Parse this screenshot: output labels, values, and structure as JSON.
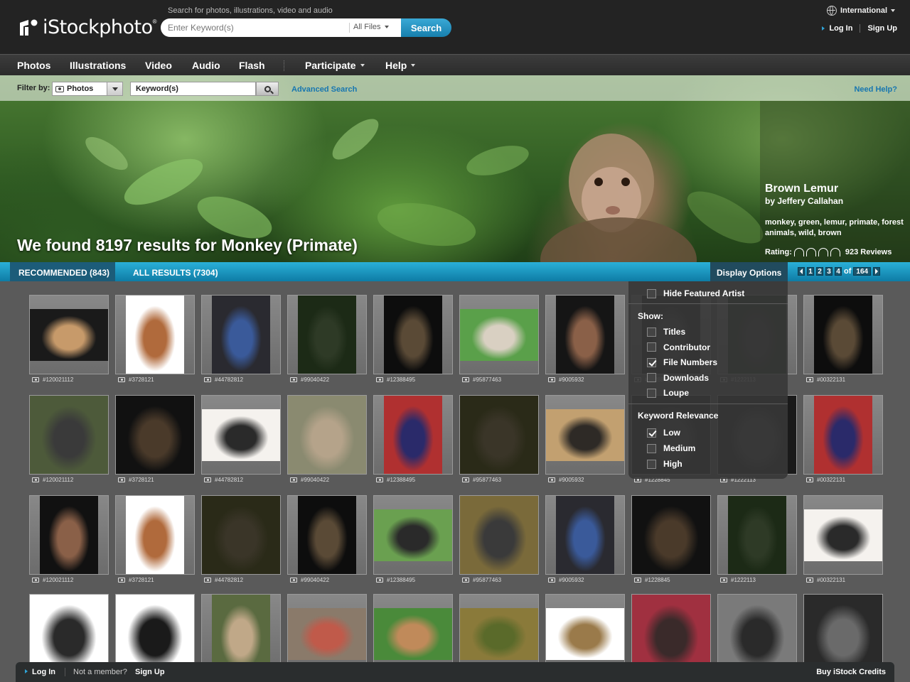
{
  "header": {
    "logo_text": "iStockphoto",
    "logo_reg": "®",
    "search_caption": "Search for photos, illustrations, video and audio",
    "search_placeholder": "Enter Keyword(s)",
    "file_filter": "All Files",
    "search_button": "Search",
    "international": "International",
    "login": "Log In",
    "signup": "Sign Up"
  },
  "nav": {
    "items": [
      "Photos",
      "Illustrations",
      "Video",
      "Audio",
      "Flash",
      "Participate",
      "Help"
    ]
  },
  "filter": {
    "label": "Filter by:",
    "type": "Photos",
    "keyword_value": "Keyword(s)",
    "advanced": "Advanced Search",
    "need_help": "Need Help?"
  },
  "hero": {
    "found_text": "We found 8197 results for Monkey (Primate)",
    "photo_title": "Brown Lemur",
    "photo_by": "by Jeffery Callahan",
    "photo_tags": "monkey, green, lemur, primate, forest animals, wild, brown",
    "rating_label": "Rating:",
    "reviews": "923 Reviews"
  },
  "results_bar": {
    "recommended": "RECOMMENDED (843)",
    "all_results": "ALL RESULTS (7304)",
    "display_options": "Display Options",
    "pages": [
      "1",
      "2",
      "3",
      "4"
    ],
    "of_label": "of",
    "total_pages": "164"
  },
  "display_options": {
    "hide_featured": "Hide Featured Artist",
    "show_label": "Show:",
    "show_items": [
      {
        "label": "Titles",
        "checked": false
      },
      {
        "label": "Contributor",
        "checked": false
      },
      {
        "label": "File Numbers",
        "checked": true
      },
      {
        "label": "Downloads",
        "checked": false
      },
      {
        "label": "Loupe",
        "checked": false
      }
    ],
    "relevance_label": "Keyword Relevance",
    "relevance_items": [
      {
        "label": "Low",
        "checked": true
      },
      {
        "label": "Medium",
        "checked": false
      },
      {
        "label": "High",
        "checked": false
      }
    ]
  },
  "grid": {
    "rows": [
      [
        {
          "id": "#120021112",
          "bg": "#1a1a1a",
          "subject": "#c79a6a",
          "shape": "wide"
        },
        {
          "id": "#3728121",
          "bg": "#ffffff",
          "subject": "#b06a3c",
          "shape": "tall"
        },
        {
          "id": "#44782812",
          "bg": "#2a2a30",
          "subject": "#3a5a9a",
          "shape": "tall"
        },
        {
          "id": "#99040422",
          "bg": "#1c2a16",
          "subject": "#2e3a26",
          "shape": "tall"
        },
        {
          "id": "#12388495",
          "bg": "#0d0d0d",
          "subject": "#5a4a36",
          "shape": "tall"
        },
        {
          "id": "#95877463",
          "bg": "#5aa04a",
          "subject": "#d9d0c2",
          "shape": "wide"
        },
        {
          "id": "#9005932",
          "bg": "#151515",
          "subject": "#8a6048",
          "shape": "tall"
        },
        {
          "id": "#1228845",
          "bg": "#1a1a1a",
          "subject": "#444",
          "shape": "tall"
        },
        {
          "id": "#1222113",
          "bg": "#1c2a16",
          "subject": "#333",
          "shape": "tall"
        },
        {
          "id": "#00322131",
          "bg": "#0d0d0d",
          "subject": "#5a4a36",
          "shape": "tall"
        }
      ],
      [
        {
          "id": "#120021112",
          "bg": "#4d5a3a",
          "subject": "#3a3a3a",
          "shape": "square"
        },
        {
          "id": "#3728121",
          "bg": "#111",
          "subject": "#4a3a2a",
          "shape": "square"
        },
        {
          "id": "#44782812",
          "bg": "#f5f2ee",
          "subject": "#2a2a2a",
          "shape": "wide"
        },
        {
          "id": "#99040422",
          "bg": "#8a8a70",
          "subject": "#b5a38a",
          "shape": "square"
        },
        {
          "id": "#12388495",
          "bg": "#b03030",
          "subject": "#2a2a6a",
          "shape": "tall"
        },
        {
          "id": "#95877463",
          "bg": "#2a2a18",
          "subject": "#3a3528",
          "shape": "square"
        },
        {
          "id": "#9005932",
          "bg": "#c2a070",
          "subject": "#2e2a26",
          "shape": "wide"
        },
        {
          "id": "#1228845",
          "bg": "#1a1a1a",
          "subject": "#444",
          "shape": "square"
        },
        {
          "id": "#1222113",
          "bg": "#1a1a1a",
          "subject": "#444",
          "shape": "square"
        },
        {
          "id": "#00322131",
          "bg": "#b03030",
          "subject": "#2a2a6a",
          "shape": "tall"
        }
      ],
      [
        {
          "id": "#120021112",
          "bg": "#111",
          "subject": "#8a6048",
          "shape": "tall"
        },
        {
          "id": "#3728121",
          "bg": "#ffffff",
          "subject": "#b06a3c",
          "shape": "tall"
        },
        {
          "id": "#44782812",
          "bg": "#2a2a18",
          "subject": "#3a3528",
          "shape": "square"
        },
        {
          "id": "#99040422",
          "bg": "#0d0d0d",
          "subject": "#5a4a36",
          "shape": "tall"
        },
        {
          "id": "#12388495",
          "bg": "#6aa050",
          "subject": "#2a2a2a",
          "shape": "wide"
        },
        {
          "id": "#95877463",
          "bg": "#7a6a3a",
          "subject": "#3a3a3a",
          "shape": "square"
        },
        {
          "id": "#9005932",
          "bg": "#2a2a30",
          "subject": "#3a5a9a",
          "shape": "tall"
        },
        {
          "id": "#1228845",
          "bg": "#111",
          "subject": "#4a3a2a",
          "shape": "square"
        },
        {
          "id": "#1222113",
          "bg": "#1c2a16",
          "subject": "#2e3a26",
          "shape": "tall"
        },
        {
          "id": "#00322131",
          "bg": "#f5f2ee",
          "subject": "#2a2a2a",
          "shape": "wide"
        }
      ],
      [
        {
          "id": "",
          "bg": "#ffffff",
          "subject": "#2a2a2a",
          "shape": "square"
        },
        {
          "id": "",
          "bg": "#ffffff",
          "subject": "#1a1a1a",
          "shape": "square"
        },
        {
          "id": "",
          "bg": "#5a6a40",
          "subject": "#c0a888",
          "shape": "tall"
        },
        {
          "id": "",
          "bg": "#8a7a6a",
          "subject": "#c05a4a",
          "shape": "wide"
        },
        {
          "id": "",
          "bg": "#4a8a3a",
          "subject": "#c08a5a",
          "shape": "wide"
        },
        {
          "id": "",
          "bg": "#8a7a3a",
          "subject": "#5a6a2a",
          "shape": "wide"
        },
        {
          "id": "",
          "bg": "#ffffff",
          "subject": "#9a7a4a",
          "shape": "wide"
        },
        {
          "id": "",
          "bg": "#a03040",
          "subject": "#3a2a2a",
          "shape": "square"
        },
        {
          "id": "",
          "bg": "#7a7a7a",
          "subject": "#2a2a2a",
          "shape": "square"
        },
        {
          "id": "",
          "bg": "#2a2a2a",
          "subject": "#6a6a6a",
          "shape": "square"
        }
      ]
    ]
  }
}
